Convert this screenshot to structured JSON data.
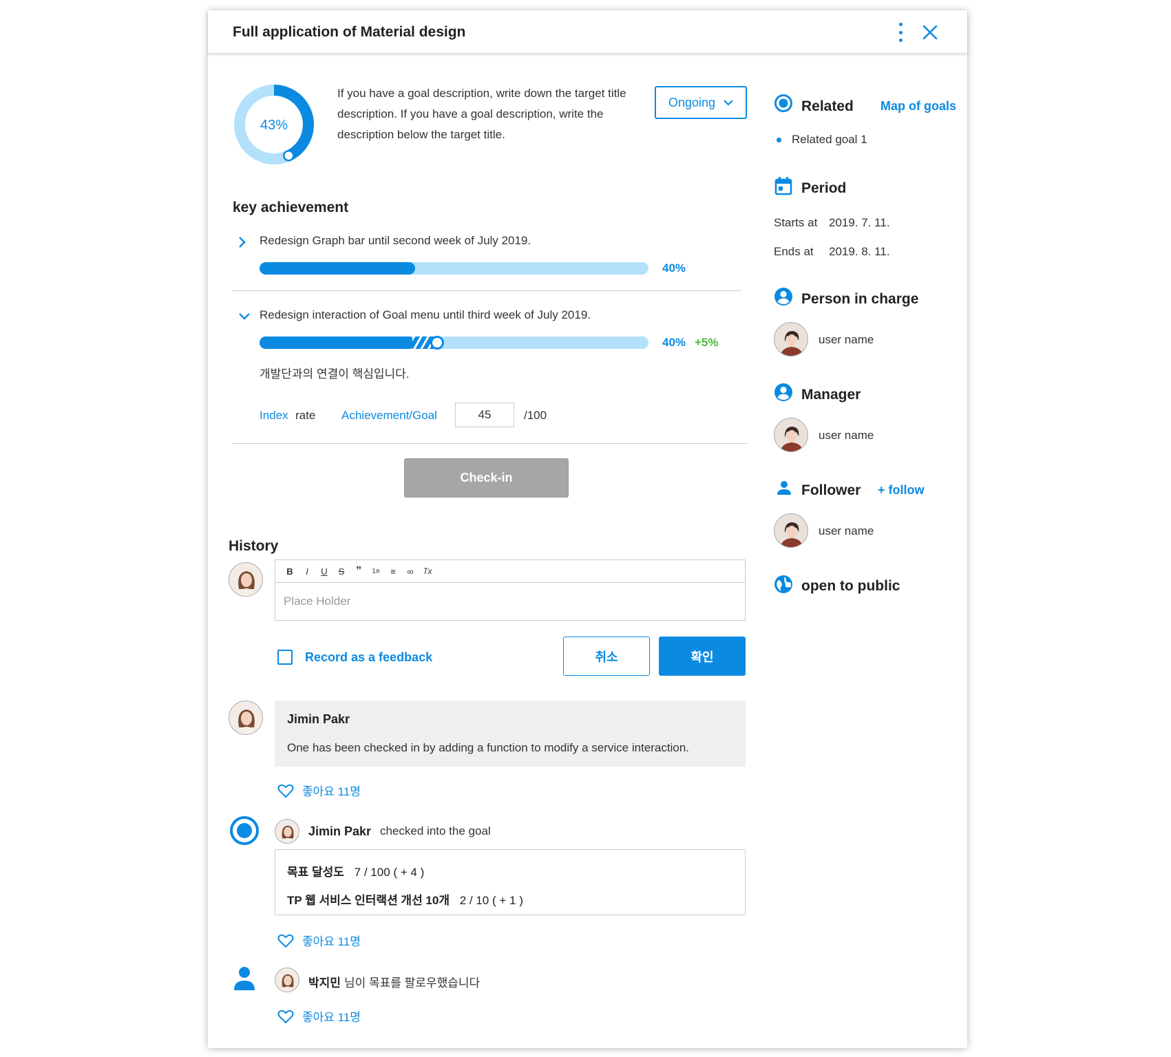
{
  "header": {
    "title": "Full application of Material design"
  },
  "goal": {
    "progress_label": "43%",
    "progress": 0.43,
    "description": "If you have a goal description, write down the target title description. If you have a goal description, write the description below the target title.",
    "status": "Ongoing"
  },
  "key_achievement": {
    "title": "key achievement",
    "items": [
      {
        "text": "Redesign Graph bar until second week of July 2019.",
        "percent_label": "40%",
        "progress": 0.4
      },
      {
        "text": "Redesign interaction of Goal menu until third week of July 2019.",
        "percent_label": "40%",
        "delta_label": "+5%",
        "progress": 0.4,
        "delta": 0.05,
        "note": "개발단과의 연결이 핵심입니다.",
        "index_label": "Index",
        "rate_label": "rate",
        "ag_label": "Achievement/Goal",
        "value": "45",
        "total": "/100"
      }
    ]
  },
  "checkin_label": "Check-in",
  "history": {
    "title": "History",
    "editor": {
      "placeholder": "Place Holder",
      "tools": [
        "B",
        "I",
        "U",
        "S",
        "”",
        "1≡",
        "≡",
        "∞",
        "Tx"
      ]
    },
    "feedback_label": "Record as a feedback",
    "cancel_label": "취소",
    "confirm_label": "확인",
    "comment": {
      "author": "Jimin Pakr",
      "text": "One has been checked in by adding a function to modify a service interaction.",
      "likes": "좋아요 11명"
    },
    "checkin_event": {
      "author": "Jimin Pakr",
      "action": "checked into the goal",
      "rows": [
        {
          "label": "목표 달성도",
          "value": "7 / 100 ( + 4 )"
        },
        {
          "label": "TP 웹 서비스 인터랙션 개선 10개",
          "value": "2 / 10 ( + 1 )"
        }
      ],
      "likes": "좋아요 11명"
    },
    "follow_event": {
      "author": "박지민",
      "action": "님이 목표를 팔로우했습니다",
      "likes": "좋아요 11명"
    }
  },
  "sidebar": {
    "related": {
      "title": "Related",
      "link": "Map of goals",
      "items": [
        "Related goal 1"
      ]
    },
    "period": {
      "title": "Period",
      "starts_label": "Starts at",
      "starts": "2019. 7. 11.",
      "ends_label": "Ends at",
      "ends": "2019. 8. 11."
    },
    "person_in_charge": {
      "title": "Person in charge",
      "user": "user name"
    },
    "manager": {
      "title": "Manager",
      "user": "user name"
    },
    "follower": {
      "title": "Follower",
      "follow": "+ follow",
      "user": "user name"
    },
    "visibility": "open to public"
  },
  "colors": {
    "accent": "#0b8ae2",
    "track": "#b3e1fb",
    "positive": "#4cbb3c",
    "disabled": "#a6a6a6"
  }
}
